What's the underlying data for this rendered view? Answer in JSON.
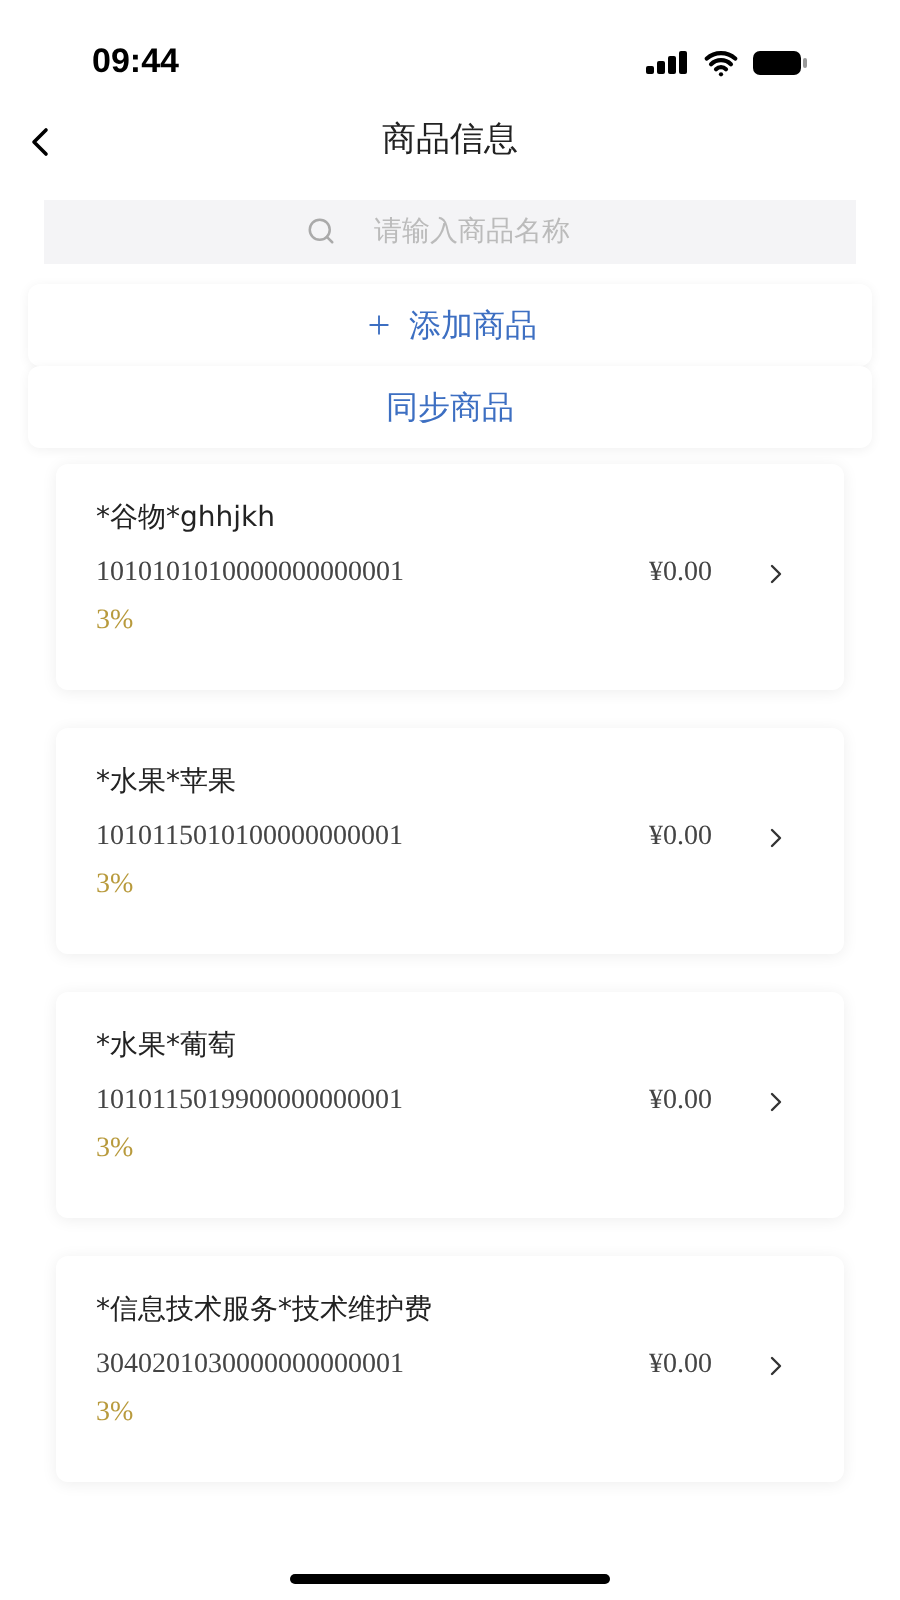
{
  "status_bar": {
    "time": "09:44"
  },
  "header": {
    "title": "商品信息"
  },
  "search": {
    "placeholder": "请输入商品名称"
  },
  "actions": [
    {
      "kind": "add",
      "label": "添加商品"
    },
    {
      "kind": "sync",
      "label": "同步商品"
    }
  ],
  "products": [
    {
      "name": "*谷物*ghhjkh",
      "code": "1010101010000000000001",
      "price": "¥0.00",
      "tax_rate": "3%"
    },
    {
      "name": "*水果*苹果",
      "code": "1010115010100000000001",
      "price": "¥0.00",
      "tax_rate": "3%"
    },
    {
      "name": "*水果*葡萄",
      "code": "1010115019900000000001",
      "price": "¥0.00",
      "tax_rate": "3%"
    },
    {
      "name": "*信息技术服务*技术维护费",
      "code": "3040201030000000000001",
      "price": "¥0.00",
      "tax_rate": "3%"
    }
  ]
}
